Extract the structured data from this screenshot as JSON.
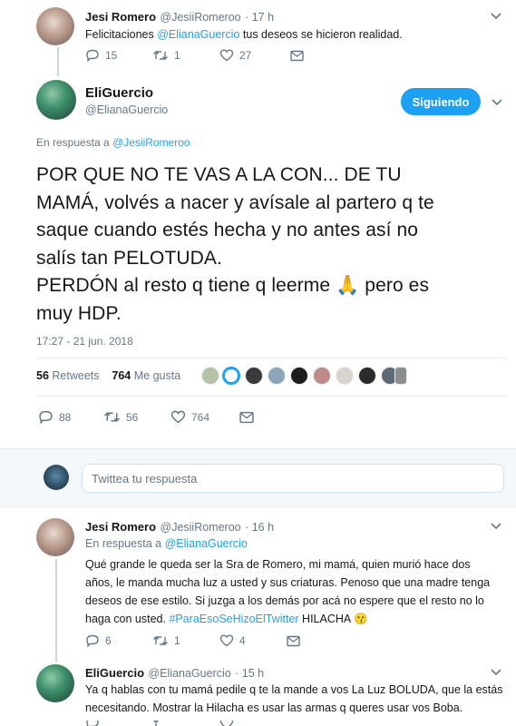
{
  "tweet1": {
    "name": "Jesi Romero",
    "handle": "@JesiiRomeroo",
    "time": "· 17 h",
    "text_prefix": "Felicitaciones ",
    "mention": "@ElianaGuercio",
    "text_suffix": " tus deseos se hicieron realidad.",
    "replies": "15",
    "retweets": "1",
    "likes": "27"
  },
  "main": {
    "name": "EliGuercio",
    "handle": "@ElianaGuercio",
    "follow_label": "Siguiendo",
    "reply_to_prefix": "En respuesta a ",
    "reply_to_handle": "@JesiiRomeroo",
    "text_line1": "POR QUE NO TE VAS A LA CON... DE TU",
    "text_line2": "MAMÁ, volvés a nacer y avísale al partero q te",
    "text_line3": "saque cuando estés hecha y no antes así no",
    "text_line4": "salís tan PELOTUDA.",
    "text_line5_a": "PERDÓN al resto q tiene q leerme",
    "text_line5_emoji": "🙏",
    "text_line5_b": " pero es",
    "text_line6": "muy HDP.",
    "timestamp": "17:27 - 21 jun. 2018",
    "retweets_count": "56",
    "retweets_label": "Retweets",
    "likes_count": "764",
    "likes_label": "Me gusta",
    "replies": "88",
    "retweets": "56",
    "likes": "764"
  },
  "reply_box": {
    "placeholder": "Twittea tu respuesta"
  },
  "tweet3": {
    "name": "Jesi Romero",
    "handle": "@JesiiRomeroo",
    "time": "· 16 h",
    "reply_to_prefix": "En respuesta a ",
    "reply_to_handle": "@ElianaGuercio",
    "line1": "Qué grande le queda ser la Sra de Romero, mi mamá, quien murió hace dos",
    "line2": "años, le manda mucha luz a usted y sus criaturas. Penoso que una madre tenga",
    "line3": "deseos de ese estilo. Si juzga a los demás por acá no espere que el resto no lo",
    "line4_prefix": "haga con usted. ",
    "hashtag": "#ParaEsoSeHizoElTwitter",
    "line4_suffix": " HILACHA ",
    "emoji": "😗",
    "replies": "6",
    "retweets": "1",
    "likes": "4"
  },
  "tweet4": {
    "name": "EliGuercio",
    "handle": "@ElianaGuercio",
    "time": "· 15 h",
    "line1": "Ya q hablas con tu mamá pedile q te la mande a vos La Luz BOLUDA, que la estás",
    "line2": "necesitando. Mostrar la Hilacha es usar las armas q queres usar vos Boba."
  },
  "colors": {
    "accent": "#1da1f2",
    "muted": "#657786",
    "text": "#14171a"
  }
}
